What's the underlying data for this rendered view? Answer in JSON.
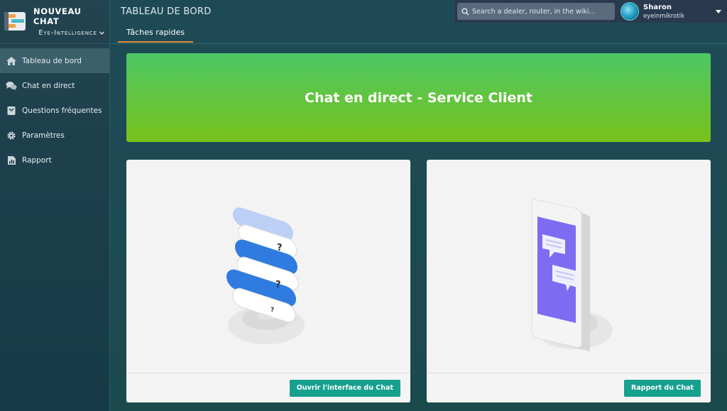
{
  "brand": {
    "title": "NOUVEAU CHAT",
    "subtitle": "Eye-Intelligence"
  },
  "sidebar": {
    "items": [
      {
        "label": "Tableau de bord",
        "icon": "home-icon",
        "active": true
      },
      {
        "label": "Chat en direct",
        "icon": "chat-bubbles-icon",
        "active": false
      },
      {
        "label": "Questions fréquentes",
        "icon": "book-icon",
        "active": false
      },
      {
        "label": "Paramètres",
        "icon": "gear-icon",
        "active": false
      },
      {
        "label": "Rapport",
        "icon": "report-icon",
        "active": false
      }
    ]
  },
  "header": {
    "title": "TABLEAU DE BORD",
    "tab": "Tâches rapides",
    "search_placeholder": "Search a dealer, router, in the wiki...",
    "user": {
      "name": "Sharon",
      "handle": "eyeinmikrotik"
    }
  },
  "banner": {
    "title": "Chat en direct - Service Client"
  },
  "cards": [
    {
      "button": "Ouvrir l'interface du Chat",
      "illustration": "chat-bubbles-illustration"
    },
    {
      "button": "Rapport du Chat",
      "illustration": "phone-chat-illustration"
    }
  ],
  "colors": {
    "accent_button": "#16a08e",
    "banner_top": "#4cc766",
    "banner_bottom": "#78c21a",
    "tab_underline": "#e58b3a",
    "sidebar_active": "#3b5f6b"
  }
}
